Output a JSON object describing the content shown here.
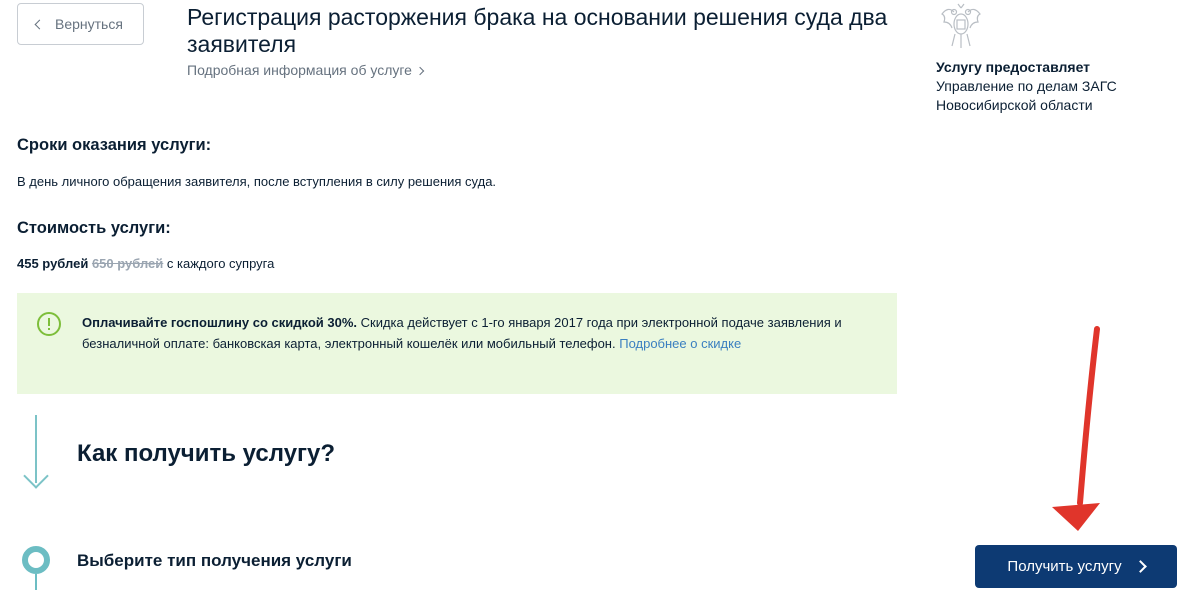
{
  "header": {
    "back_label": "Вернуться",
    "title": "Регистрация расторжения брака на основании решения суда два заявителя",
    "info_link": "Подробная информация об услуге"
  },
  "provider": {
    "emblem_icon": "russian-coat-of-arms",
    "heading": "Услугу предоставляет",
    "name_line1": "Управление по делам ЗАГС",
    "name_line2": "Новосибирской области"
  },
  "terms": {
    "heading": "Сроки оказания услуги:",
    "text": "В день личного обращения заявителя, после вступления в силу решения суда."
  },
  "cost": {
    "heading": "Стоимость услуги:",
    "price": "455 рублей",
    "old_price": "650 рублей",
    "suffix": "с каждого супруга"
  },
  "discount": {
    "icon": "exclamation-circle-icon",
    "strong": "Оплачивайте госпошлину со скидкой 30%.",
    "text": " Скидка действует с 1-го января 2017 года при электронной подаче заявления и безналичной оплате: банковская карта, электронный кошелёк или мобильный телефон. ",
    "link": "Подробнее о скидке"
  },
  "how": {
    "title": "Как получить услугу?",
    "step_label": "Выберите тип получения услуги"
  },
  "action": {
    "get_button": "Получить услугу"
  },
  "colors": {
    "primary_button": "#0d3a73",
    "accent_teal": "#6cbdc3",
    "discount_bg": "#ebf8df",
    "annotation_arrow": "#e0352b"
  }
}
